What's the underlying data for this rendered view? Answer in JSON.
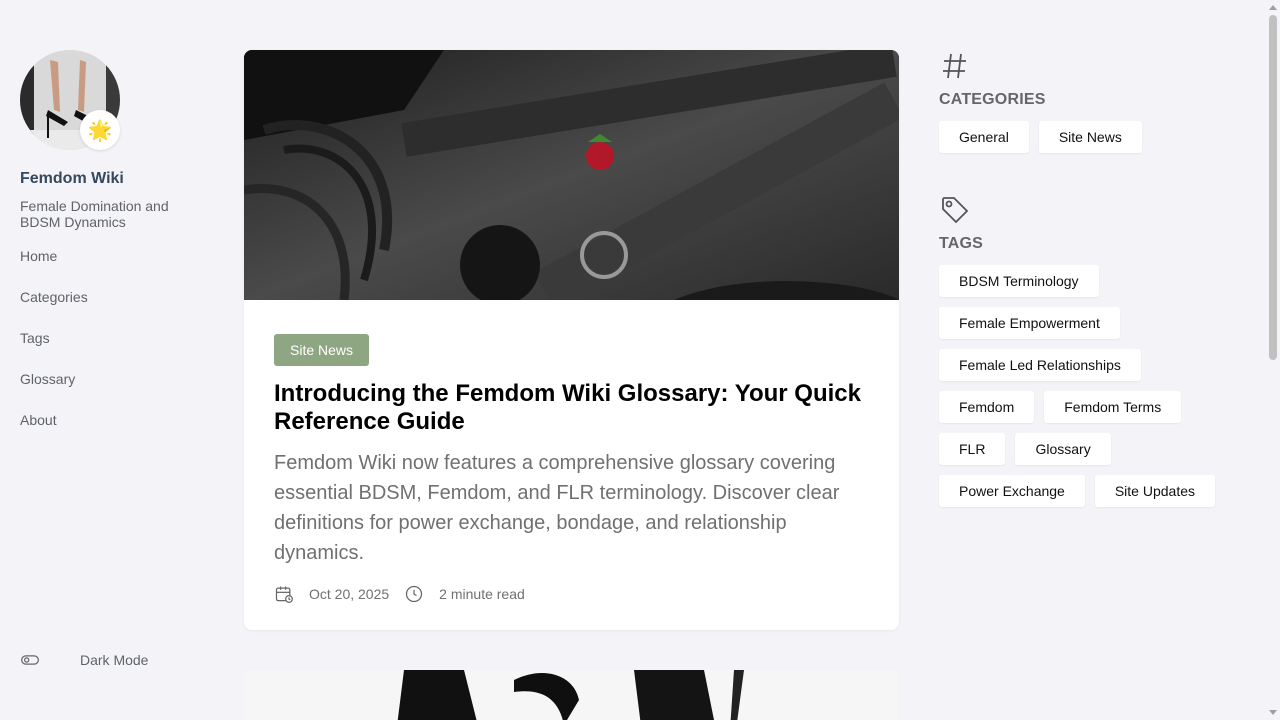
{
  "site": {
    "title": "Femdom Wiki",
    "description": "Female Domination and BDSM Dynamics",
    "avatar_badge": "🌟"
  },
  "nav": {
    "items": [
      "Home",
      "Categories",
      "Tags",
      "Glossary",
      "About"
    ]
  },
  "dark_mode": {
    "label": "Dark Mode"
  },
  "post": {
    "category": "Site News",
    "title": "Introducing the Femdom Wiki Glossary: Your Quick Reference Guide",
    "excerpt": "Femdom Wiki now features a comprehensive glossary covering essential BDSM, Femdom, and FLR terminology. Discover clear definitions for power exchange, bondage, and relationship dynamics.",
    "date": "Oct 20, 2025",
    "read_time": "2 minute read"
  },
  "categories": {
    "icon": "hash-icon",
    "title": "CATEGORIES",
    "items": [
      "General",
      "Site News"
    ]
  },
  "tags": {
    "icon": "tag-icon",
    "title": "TAGS",
    "items": [
      "BDSM Terminology",
      "Female Empowerment",
      "Female Led Relationships",
      "Femdom",
      "Femdom Terms",
      "FLR",
      "Glossary",
      "Power Exchange",
      "Site Updates"
    ]
  },
  "colors": {
    "background": "#f4f4f8",
    "badge": "#8fa683",
    "title": "#34495e"
  }
}
